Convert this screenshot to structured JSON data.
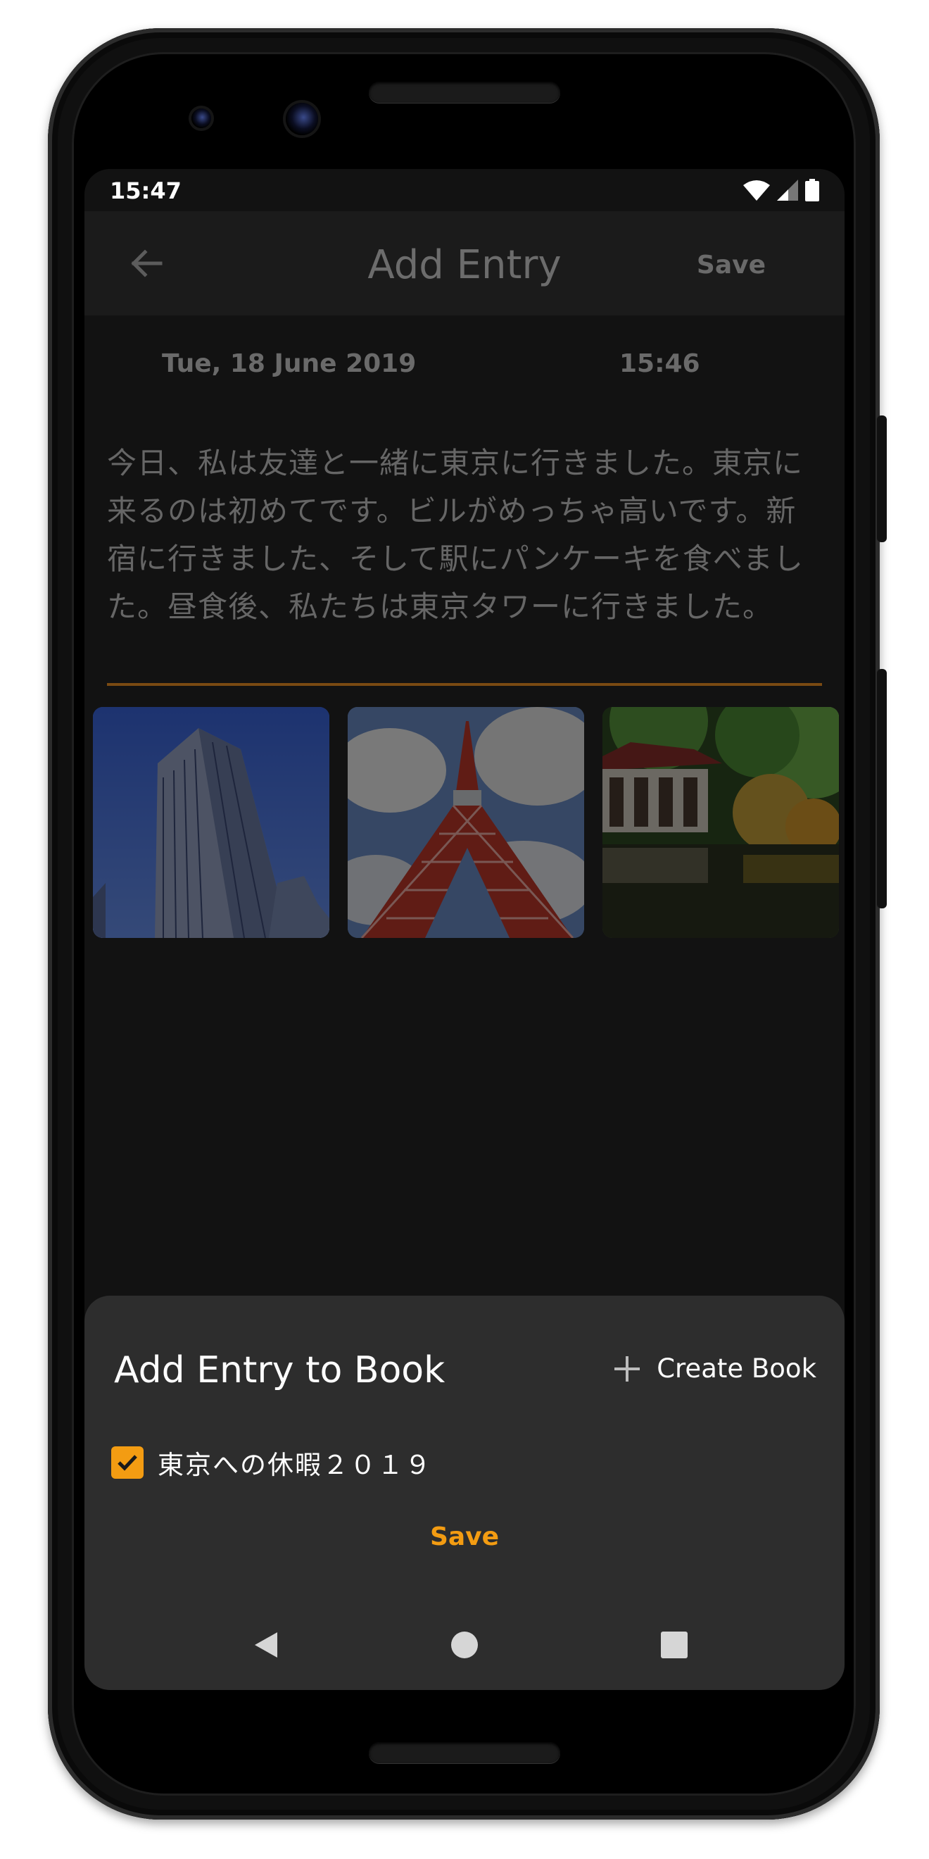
{
  "status_bar": {
    "time": "15:47",
    "icons": [
      "wifi-icon",
      "signal-icon",
      "battery-icon"
    ]
  },
  "app_bar": {
    "back_icon": "arrow-left-icon",
    "title": "Add Entry",
    "save_label": "Save"
  },
  "entry": {
    "date": "Tue, 18 June 2019",
    "time": "15:46",
    "body": "今日、私は友達と一緒に東京に行きました。東京に来るのは初めてです。ビルがめっちゃ高いです。新宿に行きました、そして駅にパンケーキを食べました。昼食後、私たちは東京タワーに行きました。"
  },
  "photos": [
    "skyscraper-photo",
    "tokyo-tower-photo",
    "japanese-garden-photo"
  ],
  "sheet": {
    "title": "Add Entry to Book",
    "create_book_label": "Create Book",
    "books": [
      {
        "label": "東京への休暇２０１９",
        "checked": true
      }
    ],
    "save_label": "Save"
  },
  "nav_bar": {
    "buttons": [
      "back-triangle-icon",
      "home-circle-icon",
      "recents-square-icon"
    ]
  },
  "colors": {
    "accent": "#f39c12",
    "sheet_bg": "#2d2d2d",
    "screen_bg": "#121212"
  }
}
